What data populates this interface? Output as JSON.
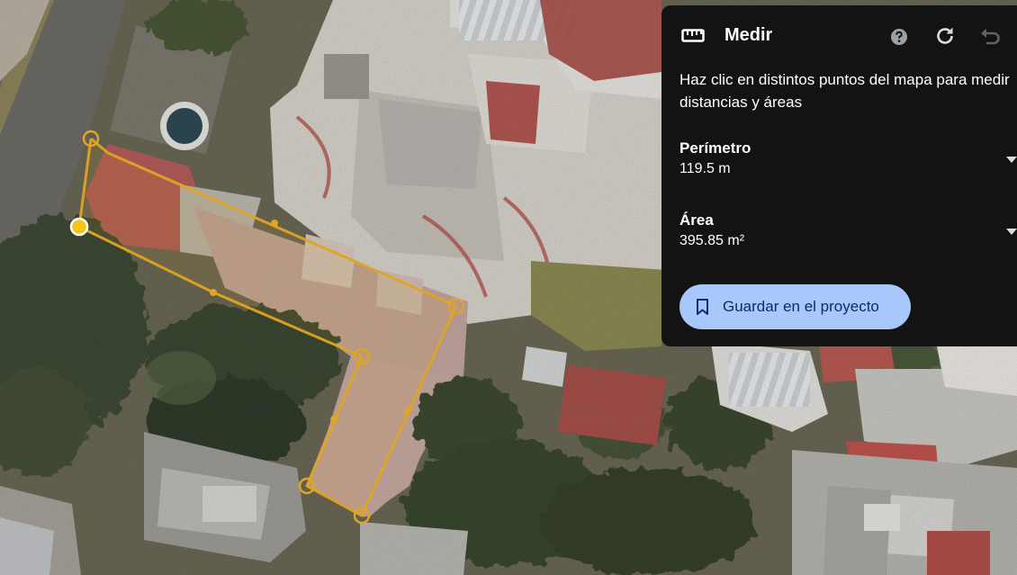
{
  "map": {
    "type": "satellite-3d",
    "measure_color": "#e0a522",
    "vertex_color": "#f5c518"
  },
  "panel": {
    "title": "Medir",
    "icon": "ruler-icon",
    "description_line1": "Haz clic en distintos puntos del mapa para medir",
    "description_line2": "distancias y áreas",
    "perimeter": {
      "label": "Perímetro",
      "value": "119.5 m"
    },
    "area": {
      "label": "Área",
      "value": "395.85 m²"
    },
    "save_label": "Guardar en el proyecto",
    "actions": [
      "help-icon",
      "reload-icon",
      "undo-icon"
    ],
    "accent_color": "#a8c7fa",
    "background_color": "#131313"
  }
}
